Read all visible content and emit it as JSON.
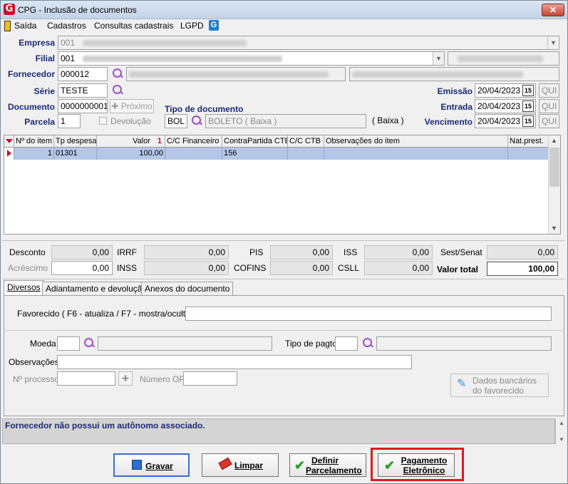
{
  "window": {
    "title": "CPG - Inclusão de documentos",
    "close_label": "✕"
  },
  "menu": {
    "items": [
      "Saída",
      "Cadastros",
      "Consultas cadastrais",
      "LGPD"
    ]
  },
  "header": {
    "empresa_label": "Empresa",
    "empresa_code": "001",
    "filial_label": "Filial",
    "filial_code": "001",
    "fornecedor_label": "Fornecedor",
    "fornecedor_code": "000012",
    "serie_label": "Série",
    "serie_value": "TESTE",
    "documento_label": "Documento",
    "documento_value": "0000000001",
    "proximo_label": "Próximo",
    "parcela_label": "Parcela",
    "parcela_value": "1",
    "devolucao_label": "Devolução",
    "tipo_doc_label": "Tipo de documento",
    "tipo_doc_code": "BOL",
    "tipo_doc_desc": "BOLETO ( Baixa )",
    "tipo_doc_extra": "( Baixa )",
    "emissao_label": "Emissão",
    "emissao_value": "20/04/2023",
    "emissao_day": "QUI",
    "entrada_label": "Entrada",
    "entrada_value": "20/04/2023",
    "entrada_day": "QUI",
    "vencimento_label": "Vencimento",
    "vencimento_value": "20/04/2023",
    "vencimento_day": "QUI",
    "cal_label": "15"
  },
  "grid": {
    "columns": [
      "Nº do item",
      "Tp despesa",
      "Valor",
      "C/C Financeiro",
      "ContraPartida CTB",
      "C/C CTB",
      "Observações do item",
      "Nat.prest."
    ],
    "sort_indicator": "1",
    "rows": [
      {
        "item": "1",
        "tp_despesa": "01301",
        "valor": "100,00",
        "cc_fin": "",
        "contrapartida": "156",
        "cc_ctb": "",
        "obs": "",
        "nat": ""
      }
    ]
  },
  "totals": {
    "desconto_label": "Desconto",
    "desconto": "0,00",
    "irrf_label": "IRRF",
    "irrf": "0,00",
    "pis_label": "PIS",
    "pis": "0,00",
    "iss_label": "ISS",
    "iss": "0,00",
    "sest_label": "Sest/Senat",
    "sest": "0,00",
    "acrescimo_label": "Acréscimo",
    "acrescimo": "0,00",
    "inss_label": "INSS",
    "inss": "0,00",
    "cofins_label": "COFINS",
    "cofins": "0,00",
    "csll_label": "CSLL",
    "csll": "0,00",
    "valor_total_label": "Valor total",
    "valor_total": "100,00"
  },
  "tabs": [
    "Diversos",
    "Adiantamento e devolução",
    "Anexos do documento"
  ],
  "diversos": {
    "favorecido_label": "Favorecido ( F6 - atualiza / F7 - mostra/oculta )",
    "moeda_label": "Moeda",
    "tipo_pagto_label": "Tipo de pagto",
    "observacoes_label": "Observações",
    "nprocesso_label": "Nº processo",
    "numero_op_label": "Número OP",
    "dados_bancarios_line1": "Dados bancários",
    "dados_bancarios_line2": "do favorecido"
  },
  "status": {
    "message": "Fornecedor não possui um autônomo associado."
  },
  "buttons": {
    "gravar": "Gravar",
    "limpar": "Limpar",
    "definir_line1": "Definir",
    "definir_line2": "Parcelamento",
    "pagamento_line1": "Pagamento",
    "pagamento_line2": "Eletrônico"
  },
  "colors": {
    "accent": "#1b2a74",
    "selection": "#b5c7e7",
    "highlight": "#e0191f"
  }
}
